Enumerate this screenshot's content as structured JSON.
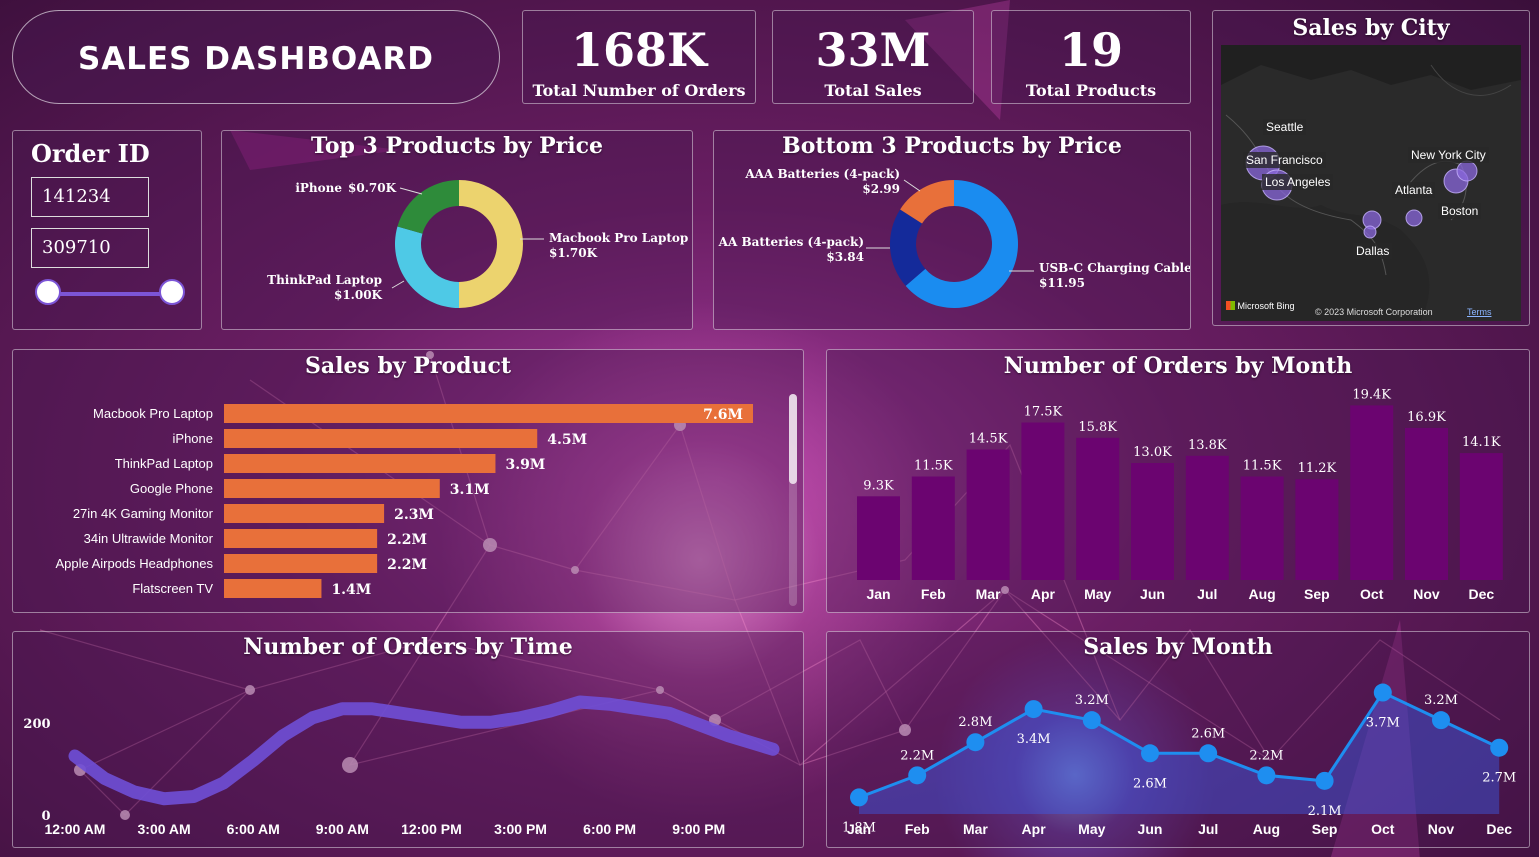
{
  "header": {
    "title": "SALES DASHBOARD"
  },
  "kpis": [
    {
      "value": "168K",
      "label": "Total Number of Orders"
    },
    {
      "value": "33M",
      "label": "Total Sales"
    },
    {
      "value": "19",
      "label": "Total Products"
    }
  ],
  "order_filter": {
    "title": "Order ID",
    "min_value": "141234",
    "max_value": "309710",
    "slider_range": [
      0,
      1
    ]
  },
  "sales_by_city": {
    "title": "Sales by City",
    "cities": [
      "Seattle",
      "San Francisco",
      "Los Angeles",
      "New York City",
      "Atlanta",
      "Boston",
      "Dallas"
    ],
    "attribution_logo": "Microsoft Bing",
    "copyright": "© 2023 Microsoft Corporation",
    "terms": "Terms"
  },
  "colors": {
    "bar_orange": "#e8703a",
    "month_bar": "#6b0470",
    "line_blue": "#1e8ef0",
    "time_line": "#6f4fd6",
    "donut_yellow": "#ecd36e",
    "donut_cyan": "#4ec9e6",
    "donut_green": "#2e8b3a",
    "donut_blue": "#1a8cf0",
    "donut_navy": "#142a9a",
    "donut_orange": "#e8703a"
  },
  "chart_data": [
    {
      "id": "top3",
      "type": "pie",
      "title": "Top 3 Products by Price",
      "categories": [
        "Macbook Pro Laptop",
        "ThinkPad Laptop",
        "iPhone"
      ],
      "values": [
        1700,
        1000,
        700
      ],
      "data_labels": [
        "$1.70K",
        "$1.00K",
        "$0.70K"
      ],
      "colors": [
        "#ecd36e",
        "#4ec9e6",
        "#2e8b3a"
      ]
    },
    {
      "id": "bottom3",
      "type": "pie",
      "title": "Bottom 3 Products by Price",
      "categories": [
        "USB-C Charging Cable",
        "AA Batteries (4-pack)",
        "AAA Batteries (4-pack)"
      ],
      "values": [
        11.95,
        3.84,
        2.99
      ],
      "data_labels": [
        "$11.95",
        "$3.84",
        "$2.99"
      ],
      "colors": [
        "#1a8cf0",
        "#142a9a",
        "#e8703a"
      ]
    },
    {
      "id": "sales_by_product",
      "type": "bar",
      "title": "Sales by Product",
      "categories": [
        "Macbook Pro Laptop",
        "iPhone",
        "ThinkPad Laptop",
        "Google Phone",
        "27in 4K Gaming Monitor",
        "34in Ultrawide Monitor",
        "Apple Airpods Headphones",
        "Flatscreen TV"
      ],
      "values": [
        7.6,
        4.5,
        3.9,
        3.1,
        2.3,
        2.2,
        2.2,
        1.4
      ],
      "data_labels": [
        "7.6M",
        "4.5M",
        "3.9M",
        "3.1M",
        "2.3M",
        "2.2M",
        "2.2M",
        "1.4M"
      ],
      "units": "M"
    },
    {
      "id": "orders_by_month",
      "type": "bar",
      "title": "Number of Orders by Month",
      "categories": [
        "Jan",
        "Feb",
        "Mar",
        "Apr",
        "May",
        "Jun",
        "Jul",
        "Aug",
        "Sep",
        "Oct",
        "Nov",
        "Dec"
      ],
      "values": [
        9.3,
        11.5,
        14.5,
        17.5,
        15.8,
        13.0,
        13.8,
        11.5,
        11.2,
        19.4,
        16.9,
        14.1
      ],
      "data_labels": [
        "9.3K",
        "11.5K",
        "14.5K",
        "17.5K",
        "15.8K",
        "13.0K",
        "13.8K",
        "11.5K",
        "11.2K",
        "19.4K",
        "16.9K",
        "14.1K"
      ],
      "units": "K"
    },
    {
      "id": "orders_by_time",
      "type": "line",
      "title": "Number of Orders by Time",
      "x_ticks": [
        "12:00 AM",
        "3:00 AM",
        "6:00 AM",
        "9:00 AM",
        "12:00 PM",
        "3:00 PM",
        "6:00 PM",
        "9:00 PM"
      ],
      "y_ticks": [
        "0",
        "200"
      ],
      "ylim": [
        0,
        200
      ],
      "x": [
        0,
        1,
        2,
        3,
        4,
        5,
        6,
        7,
        8,
        9,
        10,
        11,
        12,
        13,
        14,
        15,
        16,
        17,
        18,
        19,
        20,
        21,
        22,
        23.5
      ],
      "y": [
        120,
        70,
        40,
        25,
        30,
        60,
        110,
        165,
        205,
        225,
        225,
        215,
        205,
        195,
        195,
        205,
        220,
        240,
        235,
        225,
        215,
        190,
        165,
        135
      ]
    },
    {
      "id": "sales_by_month",
      "type": "area",
      "title": "Sales by Month",
      "categories": [
        "Jan",
        "Feb",
        "Mar",
        "Apr",
        "May",
        "Jun",
        "Jul",
        "Aug",
        "Sep",
        "Oct",
        "Nov",
        "Dec"
      ],
      "values": [
        1.8,
        2.2,
        2.8,
        3.4,
        3.2,
        2.6,
        2.6,
        2.2,
        2.1,
        3.7,
        3.2,
        2.7
      ],
      "data_labels": [
        "1.8M",
        "2.2M",
        "2.8M",
        "3.4M",
        "3.2M",
        "2.6M",
        "2.6M",
        "2.2M",
        "2.1M",
        "3.7M",
        "3.2M",
        "2.7M"
      ],
      "units": "M"
    }
  ]
}
